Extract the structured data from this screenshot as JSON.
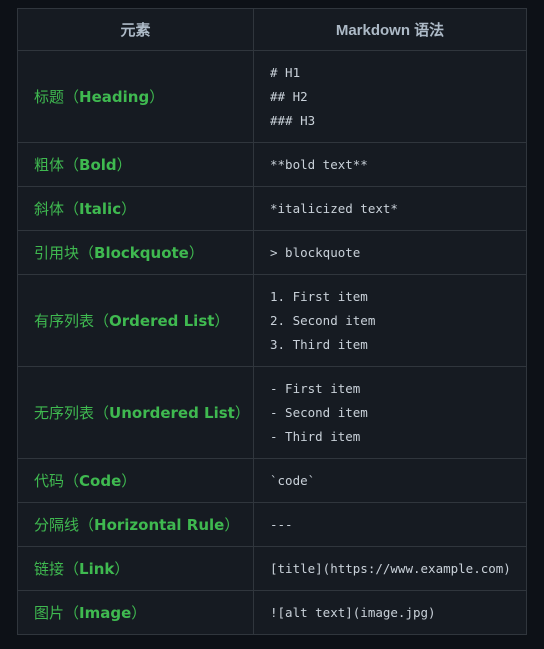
{
  "table": {
    "headers": [
      "元素",
      "Markdown 语法"
    ],
    "rows": [
      {
        "element_cn": "标题",
        "element_en": "Heading",
        "syntax": [
          "# H1",
          "## H2",
          "### H3"
        ]
      },
      {
        "element_cn": "粗体",
        "element_en": "Bold",
        "syntax": [
          "**bold text**"
        ]
      },
      {
        "element_cn": "斜体",
        "element_en": "Italic",
        "syntax": [
          "*italicized text*"
        ]
      },
      {
        "element_cn": "引用块",
        "element_en": "Blockquote",
        "syntax": [
          "> blockquote"
        ]
      },
      {
        "element_cn": "有序列表",
        "element_en": "Ordered List",
        "syntax": [
          "1. First item",
          "2. Second item",
          "3. Third item"
        ]
      },
      {
        "element_cn": "无序列表",
        "element_en": "Unordered List",
        "syntax": [
          "- First item",
          "- Second item",
          "- Third item"
        ]
      },
      {
        "element_cn": "代码",
        "element_en": "Code",
        "syntax": [
          "`code`"
        ]
      },
      {
        "element_cn": "分隔线",
        "element_en": "Horizontal Rule",
        "syntax": [
          "---"
        ]
      },
      {
        "element_cn": "链接",
        "element_en": "Link",
        "syntax": [
          "[title](https://www.example.com)"
        ]
      },
      {
        "element_cn": "图片",
        "element_en": "Image",
        "syntax": [
          "![alt text](image.jpg)"
        ]
      }
    ]
  },
  "colors": {
    "background": "#0d1117",
    "table_background": "#161b22",
    "border": "#30363d",
    "header_text": "#adbac7",
    "element_text": "#3fb950",
    "code_text": "#c9d1d9"
  }
}
